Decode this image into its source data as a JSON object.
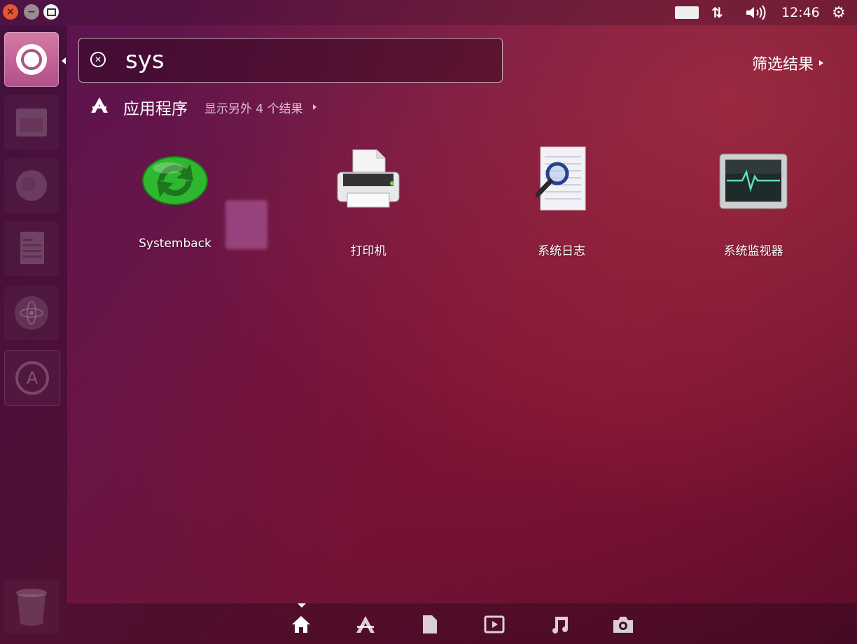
{
  "top_panel": {
    "clock": "12:46",
    "icons": [
      "close-icon",
      "minimize-icon",
      "maximize-icon",
      "keyboard-indicator-icon",
      "network-icon",
      "volume-icon",
      "session-gear-icon"
    ]
  },
  "launcher": {
    "items": [
      "dash-home",
      "files",
      "firefox",
      "libreoffice-writer",
      "atom",
      "software-updater",
      "trash"
    ]
  },
  "search": {
    "query": "sys"
  },
  "filter": {
    "label": "筛选结果"
  },
  "category": {
    "title": "应用程序",
    "more": "显示另外 4 个结果"
  },
  "apps": [
    {
      "label": "Systemback",
      "icon": "systemback-icon"
    },
    {
      "label": "打印机",
      "icon": "printer-icon"
    },
    {
      "label": "系统日志",
      "icon": "system-log-icon"
    },
    {
      "label": "系统监视器",
      "icon": "system-monitor-icon"
    }
  ],
  "lenses": [
    "home-lens",
    "applications-lens",
    "files-lens",
    "video-lens",
    "music-lens",
    "photos-lens"
  ],
  "colors": {
    "accent": "#b14f86",
    "close": "#e2572f",
    "systemback_green": "#2fb82f"
  }
}
